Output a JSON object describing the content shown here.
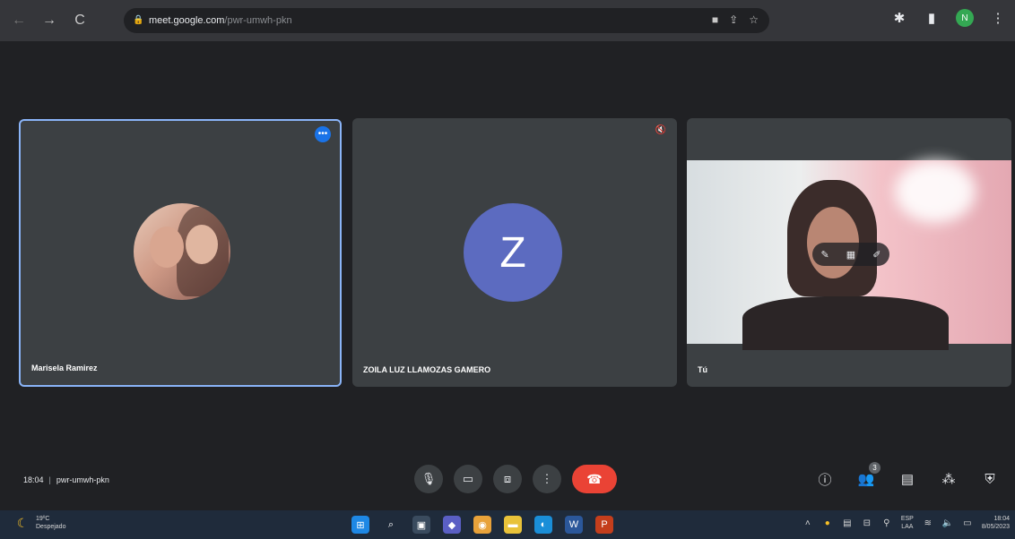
{
  "browser": {
    "url_host": "meet.google.com",
    "url_path": "/pwr-umwh-pkn",
    "profile_initial": "N"
  },
  "tiles": [
    {
      "name": "Marisela Ramirez",
      "menu_label": "•••"
    },
    {
      "name": "ZOILA LUZ LLAMOZAS GAMERO",
      "avatar_letter": "Z"
    },
    {
      "name": "Tú"
    }
  ],
  "meeting": {
    "time": "18:04",
    "separator": "|",
    "code": "pwr-umwh-pkn",
    "participant_count": "3"
  },
  "taskbar": {
    "weather_temp": "19ºC",
    "weather_desc": "Despejado",
    "lang_line1": "ESP",
    "lang_line2": "LAA",
    "clock_time": "18:04",
    "clock_date": "8/05/2023"
  },
  "colors": {
    "active_border": "#8ab4f8",
    "end_call": "#ea4335",
    "letter_avatar": "#5c6bc0",
    "meet_bg": "#202124"
  }
}
